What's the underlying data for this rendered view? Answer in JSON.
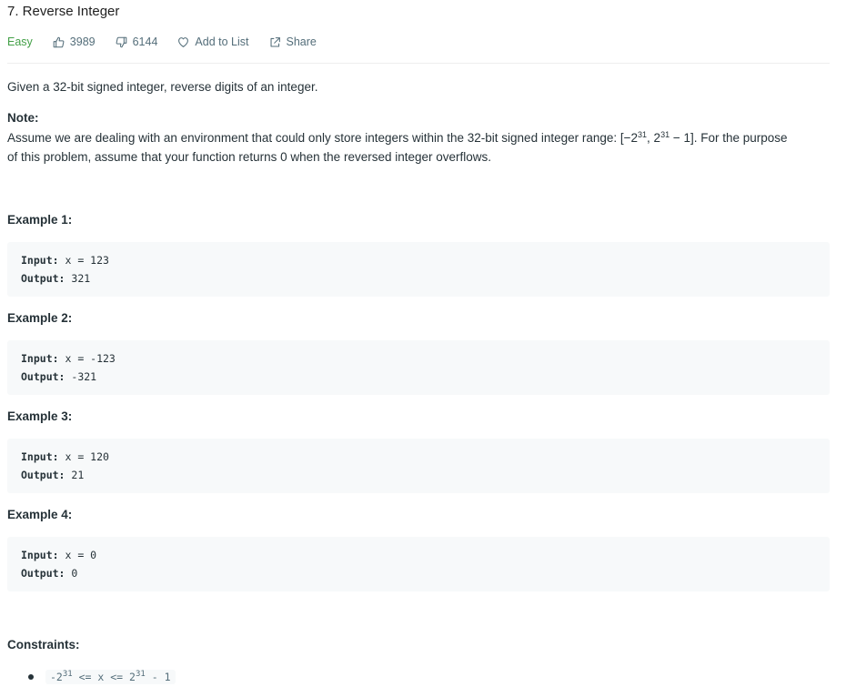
{
  "problem": {
    "title": "7. Reverse Integer",
    "difficulty": "Easy",
    "likes": "3989",
    "dislikes": "6144",
    "add_to_list": "Add to List",
    "share": "Share"
  },
  "description": {
    "intro": "Given a 32-bit signed integer, reverse digits of an integer.",
    "note_heading": "Note:",
    "note_part1": "Assume we are dealing with an environment that could only store integers within the 32-bit signed integer range: [−2",
    "note_exp1": "31",
    "note_part2": ",  2",
    "note_exp2": "31",
    "note_part3": " − 1]. For the purpose",
    "note_line2": "of this problem, assume that your function returns 0 when the reversed integer overflows."
  },
  "labels": {
    "input": "Input:",
    "output": "Output:"
  },
  "examples": [
    {
      "heading": "Example 1:",
      "input": " x = 123",
      "output": " 321"
    },
    {
      "heading": "Example 2:",
      "input": " x = -123",
      "output": " -321"
    },
    {
      "heading": "Example 3:",
      "input": " x = 120",
      "output": " 21"
    },
    {
      "heading": "Example 4:",
      "input": " x = 0",
      "output": " 0"
    }
  ],
  "constraints": {
    "heading": "Constraints:",
    "item_part1": "-2",
    "item_exp1": "31",
    "item_part2": " <= x <= 2",
    "item_exp2": "31",
    "item_part3": " - 1"
  },
  "colors": {
    "difficulty_easy": "#43a047",
    "text": "#263238",
    "muted": "#546e7a",
    "code_bg": "#f7f9fa"
  },
  "icons": [
    "thumbs-up-icon",
    "thumbs-down-icon",
    "heart-icon",
    "share-icon"
  ]
}
